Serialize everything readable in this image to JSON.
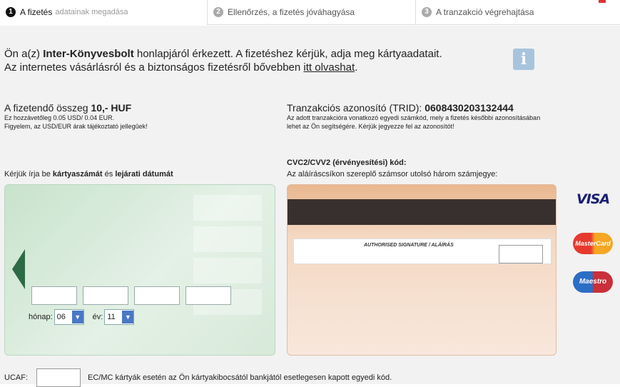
{
  "steps": {
    "step1": {
      "num": "1",
      "label": "A fizetés",
      "rest": "adatainak megadása"
    },
    "step2": {
      "num": "2",
      "label": "Ellenőrzés, a fizetés jóváhagyása"
    },
    "step3": {
      "num": "3",
      "label": "A tranzakció végrehajtása"
    }
  },
  "intro": {
    "line1_a": "Ön a(z) ",
    "merchant": "Inter-Könyvesbolt",
    "line1_b": "  honlapjáról érkezett. A fizetéshez kérjük, adja meg kártyaadatait.",
    "line2_a": "Az internetes vásárlásról és a biztonságos fizetésről bővebben ",
    "link": "itt olvashat",
    "line2_b": "."
  },
  "info_icon": "i",
  "amount": {
    "label": "A fizetendő összeg ",
    "value": "10,- HUF",
    "note1": "Ez hozzávetőleg 0.05 USD/ 0.04 EUR.",
    "note2": "Figyelem, az USD/EUR árak tájékoztató jellegûek!"
  },
  "trid": {
    "label": "Tranzakciós azonosító (TRID): ",
    "value": "0608430203132444",
    "note1": "Az adott tranzakcióra vonatkozó egyedi számkód, mely a fizetés későbbi azonosításában",
    "note2": "lehet az Ön segítségére. Kérjük jegyezze fel az azonosítót!"
  },
  "card_instruction": {
    "a": "Kérjük írja be ",
    "b": "kártyaszámát",
    "c": " és ",
    "d": "lejárati dátumát"
  },
  "expiry": {
    "month_label": "hónap:",
    "month_value": "06",
    "year_label": "év:",
    "year_value": "11"
  },
  "cvc": {
    "title": "CVC2/CVV2 (érvényesítési) kód:",
    "sub": "Az aláíráscsíkon szereplő számsor utolsó három számjegye:",
    "signature_label": "AUTHORISED SIGNATURE / ALÁÍRÁS"
  },
  "logos": {
    "visa": "VISA",
    "mastercard": "MasterCard",
    "maestro": "Maestro"
  },
  "ucaf": {
    "label": "UCAF:",
    "note": "EC/MC kártyák esetén az Ön kártyakibocsától bankjától esetlegesen kapott egyedi kód."
  }
}
